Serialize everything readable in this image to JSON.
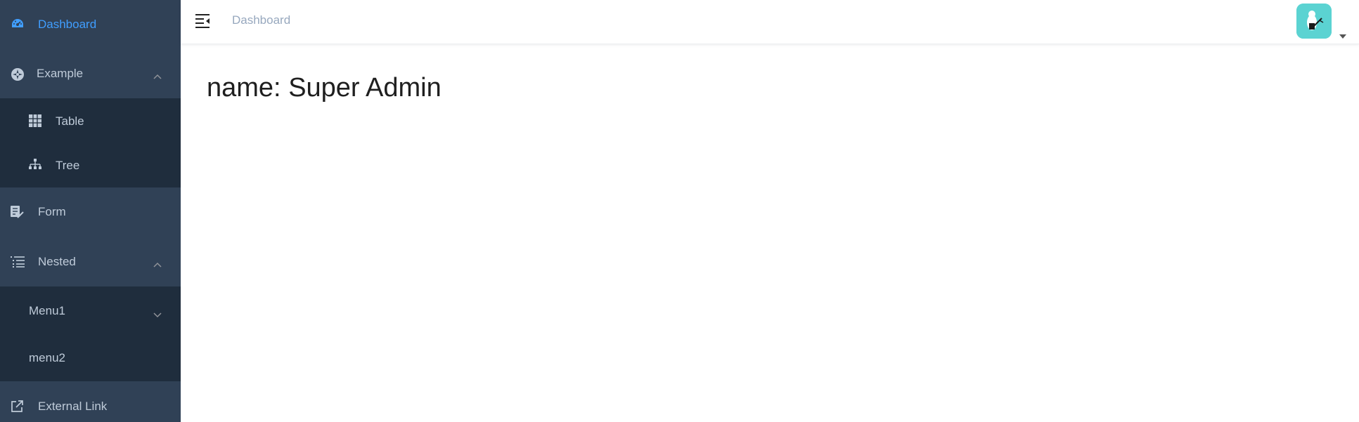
{
  "sidebar": {
    "items": [
      {
        "label": "Dashboard",
        "icon": "dashboard-icon",
        "active": true
      },
      {
        "label": "Example",
        "icon": "example-icon",
        "expanded": true,
        "children": [
          {
            "label": "Table",
            "icon": "table-icon"
          },
          {
            "label": "Tree",
            "icon": "tree-icon"
          }
        ]
      },
      {
        "label": "Form",
        "icon": "form-icon"
      },
      {
        "label": "Nested",
        "icon": "nested-icon",
        "expanded": true,
        "children": [
          {
            "label": "Menu1",
            "collapsed": true
          },
          {
            "label": "menu2"
          }
        ]
      },
      {
        "label": "External Link",
        "icon": "external-link-icon"
      }
    ]
  },
  "navbar": {
    "breadcrumb": "Dashboard",
    "avatar_bg": "#5bd3d2"
  },
  "main": {
    "name_prefix": "name:",
    "name_value": "Super Admin"
  },
  "colors": {
    "sidebar_bg": "#304156",
    "submenu_bg": "#1f2d3d",
    "active": "#409eff",
    "menu_text": "#bfcbd9"
  }
}
